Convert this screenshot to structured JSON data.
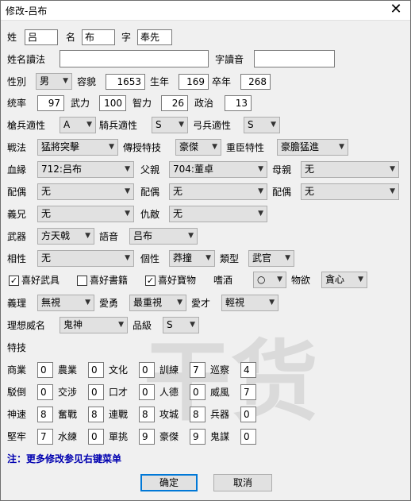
{
  "window": {
    "title": "修改-吕布"
  },
  "name": {
    "surname_label": "姓",
    "surname": "吕",
    "given_label": "名",
    "given": "布",
    "style_label": "字",
    "style": "奉先"
  },
  "reading": {
    "name_reading_label": "姓名讀法",
    "name_reading": "",
    "style_reading_label": "字讀音",
    "style_reading": ""
  },
  "bio": {
    "gender_label": "性別",
    "gender": "男",
    "looks_label": "容貌",
    "looks": "1653",
    "birth_label": "生年",
    "birth": "169",
    "death_label": "卒年",
    "death": "268"
  },
  "stats": {
    "lead_label": "统率",
    "lead": "97",
    "war_label": "武力",
    "war": "100",
    "int_label": "智力",
    "int": "26",
    "pol_label": "政治",
    "pol": "13"
  },
  "aptitude": {
    "spear_label": "槍兵適性",
    "spear": "A",
    "horse_label": "騎兵適性",
    "horse": "S",
    "bow_label": "弓兵適性",
    "bow": "S"
  },
  "tactics": {
    "tactic_label": "戦法",
    "tactic": "猛將突擊",
    "teach_label": "傳授特技",
    "teach": "豪傑",
    "retainer_label": "重臣特性",
    "retainer": "豪膽猛進"
  },
  "family": {
    "blood_label": "血縁",
    "blood": "712:吕布",
    "father_label": "父親",
    "father": "704:董卓",
    "mother_label": "母親",
    "mother": "无",
    "spouse_label": "配偶",
    "spouse1": "无",
    "spouse2": "无",
    "spouse3": "无",
    "sworn_label": "義兄",
    "sworn": "无",
    "enemy_label": "仇敵",
    "enemy": "无"
  },
  "weapon": {
    "weapon_label": "武器",
    "weapon": "方天戟",
    "voice_label": "語音",
    "voice": "吕布"
  },
  "personality": {
    "compat_label": "相性",
    "compat": "无",
    "char_label": "個性",
    "char": "莽撞",
    "type_label": "類型",
    "type": "武官"
  },
  "likes": {
    "arms_label": "喜好武具",
    "books_label": "喜好書籍",
    "treasure_label": "喜好寶物",
    "drink_label": "嗜酒",
    "drink": "○",
    "desire_label": "物欲",
    "desire": "貪心"
  },
  "values": {
    "justice_label": "義理",
    "justice": "無視",
    "courage_label": "愛勇",
    "courage": "最重視",
    "talent_label": "愛才",
    "talent": "輕視"
  },
  "ideal": {
    "ideal_label": "理想威名",
    "ideal": "鬼神",
    "rank_label": "品級",
    "rank": "S"
  },
  "skills": {
    "header": "特技",
    "rows": [
      [
        {
          "l": "商業",
          "v": "0"
        },
        {
          "l": "農業",
          "v": "0"
        },
        {
          "l": "文化",
          "v": "0"
        },
        {
          "l": "訓練",
          "v": "7"
        },
        {
          "l": "巡察",
          "v": "4"
        }
      ],
      [
        {
          "l": "駁倒",
          "v": "0"
        },
        {
          "l": "交涉",
          "v": "0"
        },
        {
          "l": "口才",
          "v": "0"
        },
        {
          "l": "人德",
          "v": "0"
        },
        {
          "l": "威風",
          "v": "7"
        }
      ],
      [
        {
          "l": "神速",
          "v": "8"
        },
        {
          "l": "奮戰",
          "v": "8"
        },
        {
          "l": "連戰",
          "v": "8"
        },
        {
          "l": "攻城",
          "v": "8"
        },
        {
          "l": "兵器",
          "v": "0"
        }
      ],
      [
        {
          "l": "堅牢",
          "v": "7"
        },
        {
          "l": "水練",
          "v": "0"
        },
        {
          "l": "單挑",
          "v": "9"
        },
        {
          "l": "豪傑",
          "v": "9"
        },
        {
          "l": "鬼謀",
          "v": "0"
        }
      ]
    ]
  },
  "footer": {
    "note": "注：更多修改参见右键菜单",
    "ok": "确定",
    "cancel": "取消"
  },
  "watermark": "干货"
}
